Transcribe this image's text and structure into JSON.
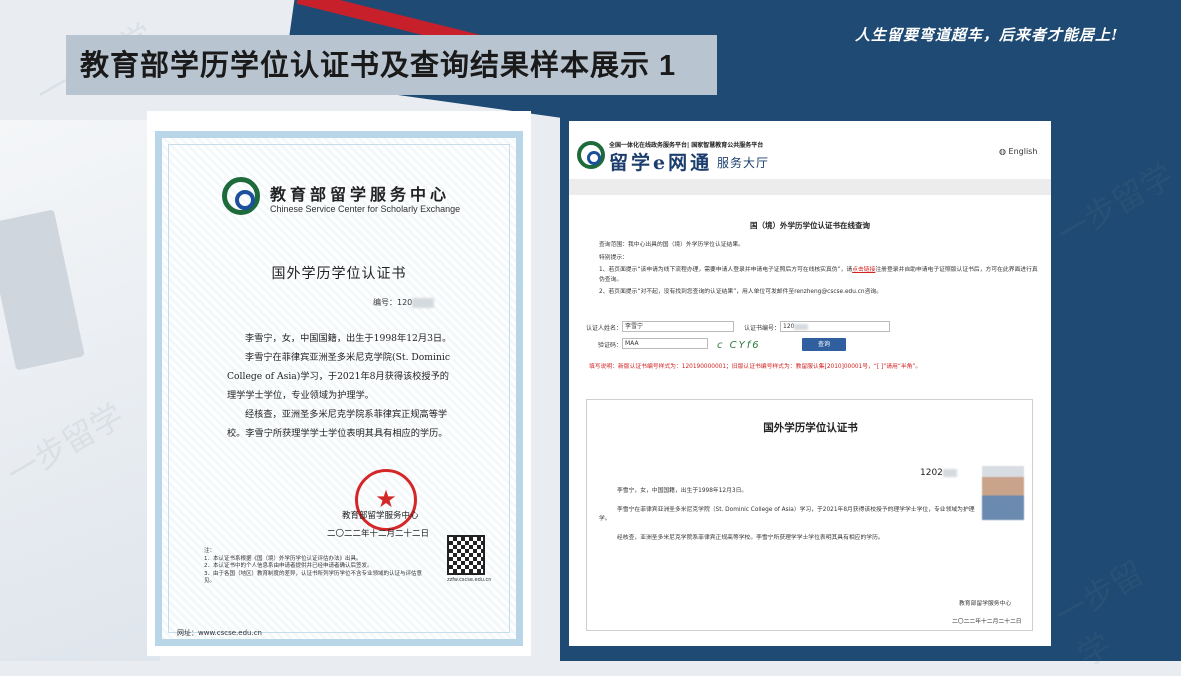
{
  "slide": {
    "title": "教育部学历学位认证书及查询结果样本展示 1",
    "slogan": "人生留要弯道超车，后来者才能居上!",
    "watermark": "一步留学"
  },
  "certificate": {
    "org_cn": "教育部留学服务中心",
    "org_en": "Chinese Service Center for Scholarly Exchange",
    "heading": "国外学历学位认证书",
    "number_label": "编号：",
    "number_visible": "120",
    "paragraphs": [
      "李雪宁，女，中国国籍，出生于1998年12月3日。",
      "李雪宁在菲律宾亚洲圣多米尼克学院(St. Dominic College of Asia)学习，于2021年8月获得该校授予的理学学士学位，专业领域为护理学。",
      "经核查，亚洲圣多米尼克学院系菲律宾正规高等学校。李雪宁所获理学学士学位表明其具有相应的学历。"
    ],
    "signature": "教育部留学服务中心",
    "date": "二〇二二年十二月二十二日",
    "notes": [
      "注：",
      "1．本认证书系根据《国（境）外学历学位认证评估办法》出具。",
      "2．本认证书中的个人信息系由申请者提供并已经申请者确认后签发。",
      "3．由于各国（地区）教育制度的差异，认证书所列学历学位不含专业领域的认证与评估意见。"
    ],
    "qr_caption": "zzfw.cscse.edu.cn",
    "url": "网址：www.cscse.edu.cn"
  },
  "query_page": {
    "top_line": "全国一体化在线政务服务平台| 国家智慧教育公共服务平台",
    "brand": "留学e网通",
    "brand_sub": "服务大厅",
    "lang": "English",
    "query_title": "国（境）外学历学位认证书在线查询",
    "scope": "查询范围：我中心出具的国（境）外学历学位认证结果。",
    "tips_label": "特别提示：",
    "tip1_before": "1、若页面提示“该申请为线下流程办理，需要申请人登录并申请电子证照后方可在线核实真伪”，请",
    "tip1_link": "点击链接",
    "tip1_after": "注册登录并自助申请电子证照版认证书后，方可在此界面进行真伪查询。",
    "tip2": "2、若页面提示“对不起，没有找到您查询的认证结果”，用人单位可发邮件至renzheng@cscse.edu.cn咨询。",
    "name_label": "认证人姓名：",
    "name_value": "李雪宁",
    "certno_label": "认证书编号：",
    "certno_value": "120",
    "captcha_label": "验证码：",
    "captcha_value": "MAA",
    "captcha_image": "c CYf6",
    "query_button": "查询",
    "hint": "填写说明：新版认证书编号样式为：120190000001；旧版认证书编号样式为：教留服认集[2010]00001号，“[ ]”请用“半角”。"
  },
  "result": {
    "title": "国外学历学位认证书",
    "number": "1202",
    "paragraphs": [
      "李雪宁，女，中国国籍，出生于1998年12月3日。",
      "李雪宁在菲律宾亚洲圣多米尼克学院（St. Dominic College of Asia）学习，于2021年8月获得该校授予的理学学士学位，专业领域为护理学。",
      "经核查，亚洲圣多米尼克学院系菲律宾正规高等学校。李雪宁所获理学学士学位表明其具有相应的学历。"
    ],
    "signature": "教育部留学服务中心",
    "date": "二〇二二年十二月二十二日"
  }
}
